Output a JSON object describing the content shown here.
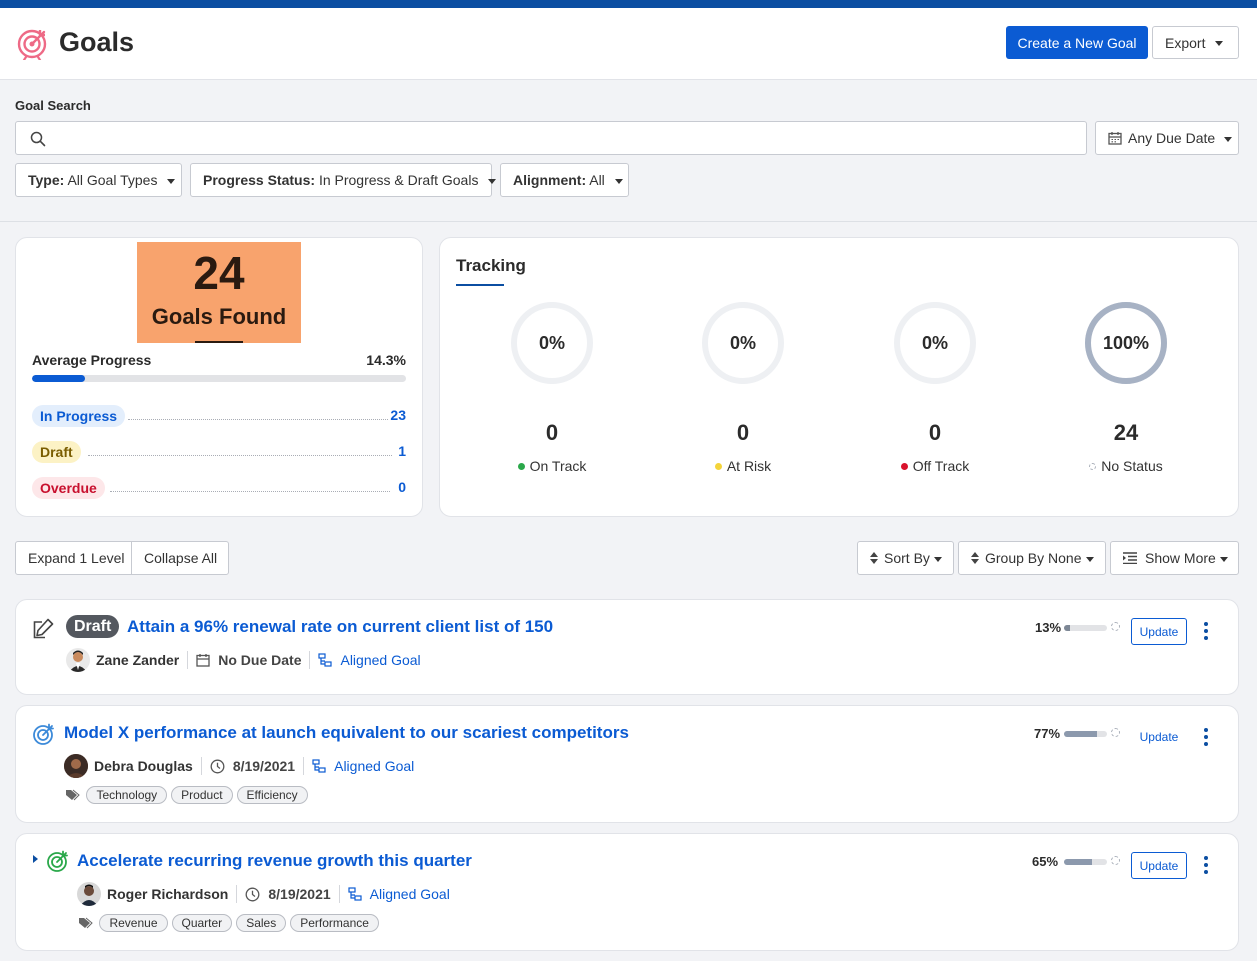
{
  "header": {
    "title": "Goals",
    "create_label": "Create a New Goal",
    "export_label": "Export"
  },
  "search": {
    "label": "Goal Search",
    "value": "",
    "placeholder": "",
    "due_date_label": "Any Due Date"
  },
  "filters": [
    {
      "key": "Type:",
      "value": "All Goal Types"
    },
    {
      "key": "Progress Status:",
      "value": "In Progress & Draft Goals"
    },
    {
      "key": "Alignment:",
      "value": "All"
    }
  ],
  "summary": {
    "count": "24",
    "count_label": "Goals Found",
    "avg_label": "Average Progress",
    "avg_value": "14.3%",
    "avg_fraction": 0.143,
    "stats": [
      {
        "label": "In Progress",
        "value": "23"
      },
      {
        "label": "Draft",
        "value": "1"
      },
      {
        "label": "Overdue",
        "value": "0"
      }
    ]
  },
  "tracking": {
    "title": "Tracking",
    "items": [
      {
        "percent": "0%",
        "fraction": 0,
        "count": "0",
        "label": "On Track",
        "color": "#2aa84a"
      },
      {
        "percent": "0%",
        "fraction": 0,
        "count": "0",
        "label": "At Risk",
        "color": "#f4d43a"
      },
      {
        "percent": "0%",
        "fraction": 0,
        "count": "0",
        "label": "Off Track",
        "color": "#d9132c"
      },
      {
        "percent": "100%",
        "fraction": 1,
        "count": "24",
        "label": "No Status",
        "color": "#a7b2c4"
      }
    ]
  },
  "toolbar": {
    "expand_label": "Expand 1 Level",
    "collapse_label": "Collapse All",
    "sort_label": "Sort By",
    "group_label": "Group By None",
    "show_more_label": "Show More"
  },
  "goals": [
    {
      "status_badge": "Draft",
      "title": "Attain a 96% renewal rate on current client list of 150",
      "owner": "Zane Zander",
      "due": "No Due Date",
      "aligned": "Aligned Goal",
      "progress": "13%",
      "progress_fraction": 0.13,
      "update_label": "Update",
      "tags": []
    },
    {
      "title": "Model X performance at launch equivalent to our scariest competitors",
      "owner": "Debra Douglas",
      "due": "8/19/2021",
      "aligned": "Aligned Goal",
      "progress": "77%",
      "progress_fraction": 0.77,
      "update_label": "Update",
      "tags": [
        "Technology",
        "Product",
        "Efficiency"
      ]
    },
    {
      "title": "Accelerate recurring revenue growth this quarter",
      "owner": "Roger Richardson",
      "due": "8/19/2021",
      "aligned": "Aligned Goal",
      "progress": "65%",
      "progress_fraction": 0.65,
      "update_label": "Update",
      "tags": [
        "Revenue",
        "Quarter",
        "Sales",
        "Performance"
      ]
    }
  ],
  "colors": {
    "accent": "#0b5bd3",
    "brand_bar": "#0b4ea2",
    "found_box": "#f8a36d"
  }
}
